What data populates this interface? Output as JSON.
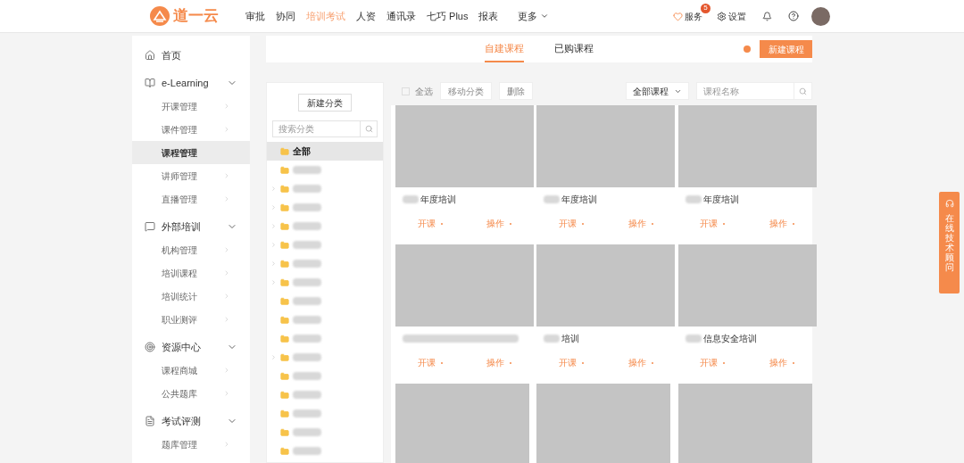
{
  "top_bar": {
    "logo_text": "道一云",
    "nav": [
      {
        "label": "审批",
        "selected": false
      },
      {
        "label": "协同",
        "selected": false
      },
      {
        "label": "培训考试",
        "selected": true
      },
      {
        "label": "人资",
        "selected": false
      },
      {
        "label": "通讯录",
        "selected": false
      },
      {
        "label": "七巧 Plus",
        "selected": false
      },
      {
        "label": "报表",
        "selected": false
      },
      {
        "label": "更多",
        "selected": false,
        "kind": "dropdown"
      }
    ],
    "service": {
      "label": "服务",
      "badge": "5"
    },
    "settings": {
      "label": "设置"
    }
  },
  "sidebar": [
    {
      "label": "首页"
    },
    {
      "label": "e-Learning",
      "expanded": true,
      "children": [
        {
          "label": "开课管理",
          "selected": false
        },
        {
          "label": "课件管理",
          "selected": false
        },
        {
          "label": "课程管理",
          "selected": true
        },
        {
          "label": "讲师管理",
          "selected": false
        },
        {
          "label": "直播管理",
          "selected": false
        }
      ]
    },
    {
      "label": "外部培训",
      "expanded": true,
      "children": [
        {
          "label": "机构管理",
          "selected": false
        },
        {
          "label": "培训课程",
          "selected": false
        },
        {
          "label": "培训统计",
          "selected": false
        },
        {
          "label": "职业测评",
          "selected": false
        }
      ]
    },
    {
      "label": "资源中心",
      "expanded": true,
      "children": [
        {
          "label": "课程商城",
          "selected": false
        },
        {
          "label": "公共题库",
          "selected": false
        }
      ]
    },
    {
      "label": "考试评测",
      "expanded": true,
      "children": [
        {
          "label": "题库管理",
          "selected": false
        }
      ]
    }
  ],
  "tabs": [
    {
      "label": "自建课程",
      "selected": true
    },
    {
      "label": "已购课程",
      "selected": false
    }
  ],
  "new_course_button": "新建课程",
  "category_panel": {
    "new_button": "新建分类",
    "search": {
      "placeholder": "搜索分类"
    },
    "folders": [
      {
        "label": "全部",
        "selected": true,
        "expandable": false
      },
      {
        "selected": false,
        "expandable": false
      },
      {
        "selected": false,
        "expandable": true
      },
      {
        "selected": false,
        "expandable": true
      },
      {
        "selected": false,
        "expandable": true
      },
      {
        "selected": false,
        "expandable": true
      },
      {
        "selected": false,
        "expandable": true
      },
      {
        "selected": false,
        "expandable": true
      },
      {
        "selected": false,
        "expandable": false
      },
      {
        "selected": false,
        "expandable": false
      },
      {
        "selected": false,
        "expandable": false
      },
      {
        "selected": false,
        "expandable": true
      },
      {
        "selected": false,
        "expandable": false
      },
      {
        "selected": false,
        "expandable": false
      },
      {
        "selected": false,
        "expandable": false
      },
      {
        "selected": false,
        "expandable": false
      },
      {
        "selected": false,
        "expandable": false
      }
    ]
  },
  "toolbar": {
    "select_all": {
      "label": "全选",
      "checked": false
    },
    "buttons": [
      {
        "label": "移动分类",
        "disabled": true
      },
      {
        "label": "删除",
        "disabled": true
      }
    ],
    "filter": "全部课程",
    "search": {
      "placeholder": "课程名称"
    }
  },
  "cards": [
    {
      "kind": "full",
      "title": "年度培训",
      "actions": [
        "开课",
        "操作"
      ]
    },
    {
      "kind": "full",
      "title": "年度培训",
      "actions": [
        "开课",
        "操作"
      ]
    },
    {
      "kind": "full",
      "title": "年度培训",
      "actions": [
        "开课",
        "操作"
      ]
    },
    {
      "kind": "full",
      "actions": [
        "开课",
        "操作"
      ]
    },
    {
      "kind": "full",
      "title": "培训",
      "actions": [
        "开课",
        "操作"
      ]
    },
    {
      "kind": "full",
      "title": "信息安全培训",
      "actions": [
        "开课",
        "操作"
      ]
    },
    {
      "kind": "cut"
    },
    {
      "kind": "cut"
    },
    {
      "kind": "cut"
    }
  ],
  "float_button": "在线技术顾问"
}
